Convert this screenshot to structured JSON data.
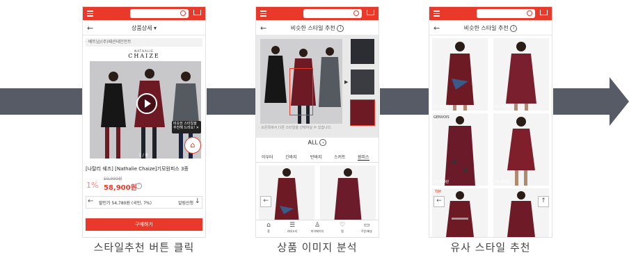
{
  "panel1": {
    "nav_title": "상품상세 ▾",
    "breadcrumb": "· 베트남/(주)패션테인먼트",
    "brand_line1": "NATHALIE",
    "brand_line2": "CHAIZE",
    "image_counter": "1 / 8",
    "tooltip": "비슷한 스타일을 추천해 드려요! ✕",
    "product_name": "[나탈리 쉐즈] [Nathalie Chaize]기모원피스 3종",
    "original_price": "59,900원",
    "discount_rate": "1%",
    "sale_price": "58,900원",
    "card_discount": "할인가 54,780원 (국민, 7%)",
    "notify_label": "알림신청",
    "buy_button": "구매하기"
  },
  "panel2": {
    "nav_title": "비슷한 스타일 추천",
    "hint": "· 오른쪽에서 다른 스타일을 선택하실 수 있습니다.",
    "all_label": "ALL",
    "tabs": [
      "아우터",
      "긴바지",
      "반바지",
      "스커트",
      "원피스"
    ],
    "active_tab": "원피스",
    "bottom_nav": [
      "홈",
      "카테고리",
      "마이페이지",
      "찜",
      "주문/배송"
    ]
  },
  "panel3": {
    "nav_title": "비슷한 스타일 추천",
    "price_tags": [
      "55,000원",
      "42,900원",
      "43,000원",
      "55,000원"
    ],
    "brand_tag_1": "GENVOIS",
    "brand_tag_2": "TIM"
  },
  "captions": [
    "스타일추천 버튼 클릭",
    "상품 이미지 분석",
    "유사 스타일 추천"
  ],
  "colors": {
    "accent": "#e8392b",
    "arrow": "#565b66",
    "burgundy": "#6d1a25"
  }
}
